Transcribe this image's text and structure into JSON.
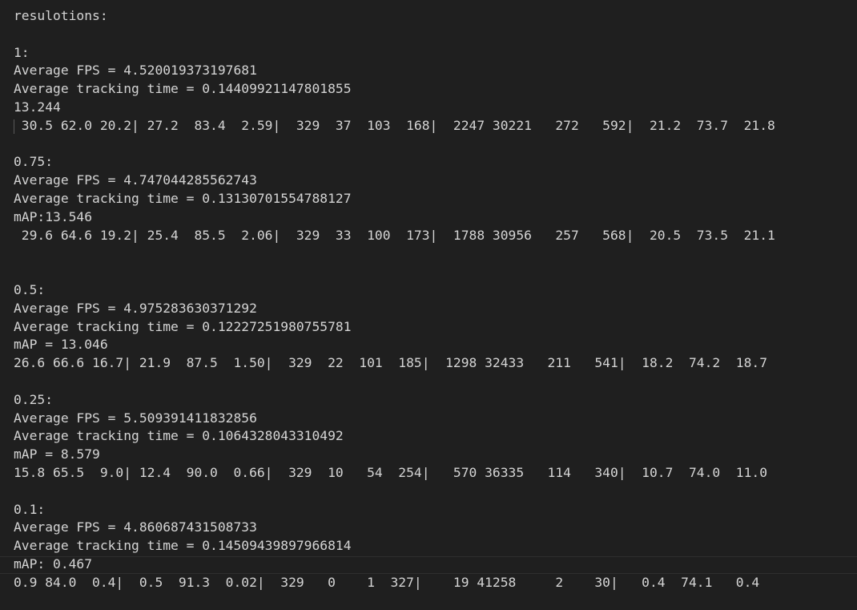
{
  "editor": {
    "lines": [
      "resulotions:",
      "",
      "1:",
      "Average FPS = 4.520019373197681",
      "Average tracking time = 0.14409921147801855",
      "13.244",
      " 30.5 62.0 20.2| 27.2  83.4  2.59|  329  37  103  168|  2247 30221   272   592|  21.2  73.7  21.8",
      "",
      "0.75:",
      "Average FPS = 4.747044285562743",
      "Average tracking time = 0.13130701554788127",
      "mAP:13.546",
      " 29.6 64.6 19.2| 25.4  85.5  2.06|  329  33  100  173|  1788 30956   257   568|  20.5  73.5  21.1",
      "",
      "",
      "0.5:",
      "Average FPS = 4.975283630371292",
      "Average tracking time = 0.12227251980755781",
      "mAP = 13.046",
      "26.6 66.6 16.7| 21.9  87.5  1.50|  329  22  101  185|  1298 32433   211   541|  18.2  74.2  18.7",
      "",
      "0.25:",
      "Average FPS = 5.509391411832856",
      "Average tracking time = 0.1064328043310492",
      "mAP = 8.579",
      "15.8 65.5  9.0| 12.4  90.0  0.66|  329  10   54  254|   570 36335   114   340|  10.7  74.0  11.0",
      "",
      "0.1:",
      "Average FPS = 4.860687431508733",
      "Average tracking time = 0.14509439897966814",
      "mAP: 0.467",
      "0.9 84.0  0.4|  0.5  91.3  0.02|  329   0    1  327|    19 41258     2    30|   0.4  74.1   0.4"
    ]
  }
}
